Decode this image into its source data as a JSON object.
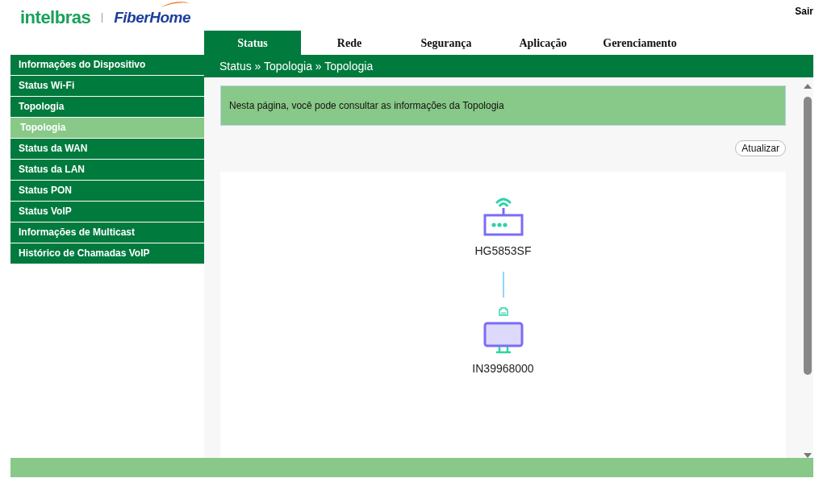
{
  "header": {
    "logo_primary": "intelbras",
    "logo_secondary": "FiberHome",
    "logout": "Sair"
  },
  "tabs": [
    {
      "label": "Status",
      "selected": true
    },
    {
      "label": "Rede",
      "selected": false
    },
    {
      "label": "Segurança",
      "selected": false
    },
    {
      "label": "Aplicação",
      "selected": false
    },
    {
      "label": "Gerenciamento",
      "selected": false
    }
  ],
  "sidebar": {
    "items": [
      {
        "label": "Informações do Dispositivo",
        "selected": false
      },
      {
        "label": "Status Wi-Fi",
        "selected": false
      },
      {
        "label": "Topologia",
        "selected": false,
        "children": [
          {
            "label": "Topologia",
            "selected": true
          }
        ]
      },
      {
        "label": "Status da WAN",
        "selected": false
      },
      {
        "label": "Status da LAN",
        "selected": false
      },
      {
        "label": "Status PON",
        "selected": false
      },
      {
        "label": "Status VoIP",
        "selected": false
      },
      {
        "label": "Informações de Multicast",
        "selected": false
      },
      {
        "label": "Histórico de Chamadas VoIP",
        "selected": false
      }
    ]
  },
  "breadcrumb": "Status » Topologia » Topologia",
  "info": "Nesta página, você pode consultar as informações da Topologia",
  "refresh_button": "Atualizar",
  "topology": {
    "nodes": [
      {
        "kind": "router",
        "label": "HG5853SF"
      },
      {
        "kind": "computer",
        "label": "IN39968000"
      }
    ]
  }
}
